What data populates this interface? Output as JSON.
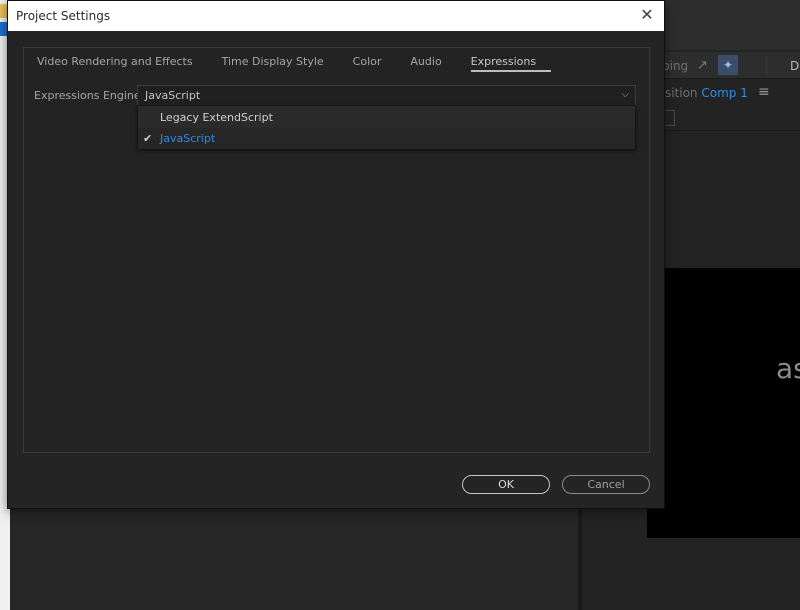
{
  "background": {
    "toolbar_text": "ping",
    "d_label": "D",
    "comp_prefix": "position",
    "comp_name": "Comp 1",
    "canvas_text": "as"
  },
  "dialog": {
    "title": "Project Settings",
    "tabs": [
      {
        "label": "Video Rendering and Effects"
      },
      {
        "label": "Time Display Style"
      },
      {
        "label": "Color"
      },
      {
        "label": "Audio"
      },
      {
        "label": "Expressions",
        "active": true
      }
    ],
    "expressions_engine": {
      "label": "Expressions Engine:",
      "value": "JavaScript",
      "options": [
        {
          "label": "Legacy ExtendScript",
          "selected": false
        },
        {
          "label": "JavaScript",
          "selected": true
        }
      ]
    },
    "buttons": {
      "ok": "OK",
      "cancel": "Cancel"
    }
  },
  "colors": {
    "accent": "#2b8ae8",
    "dialog_bg": "#242424"
  }
}
